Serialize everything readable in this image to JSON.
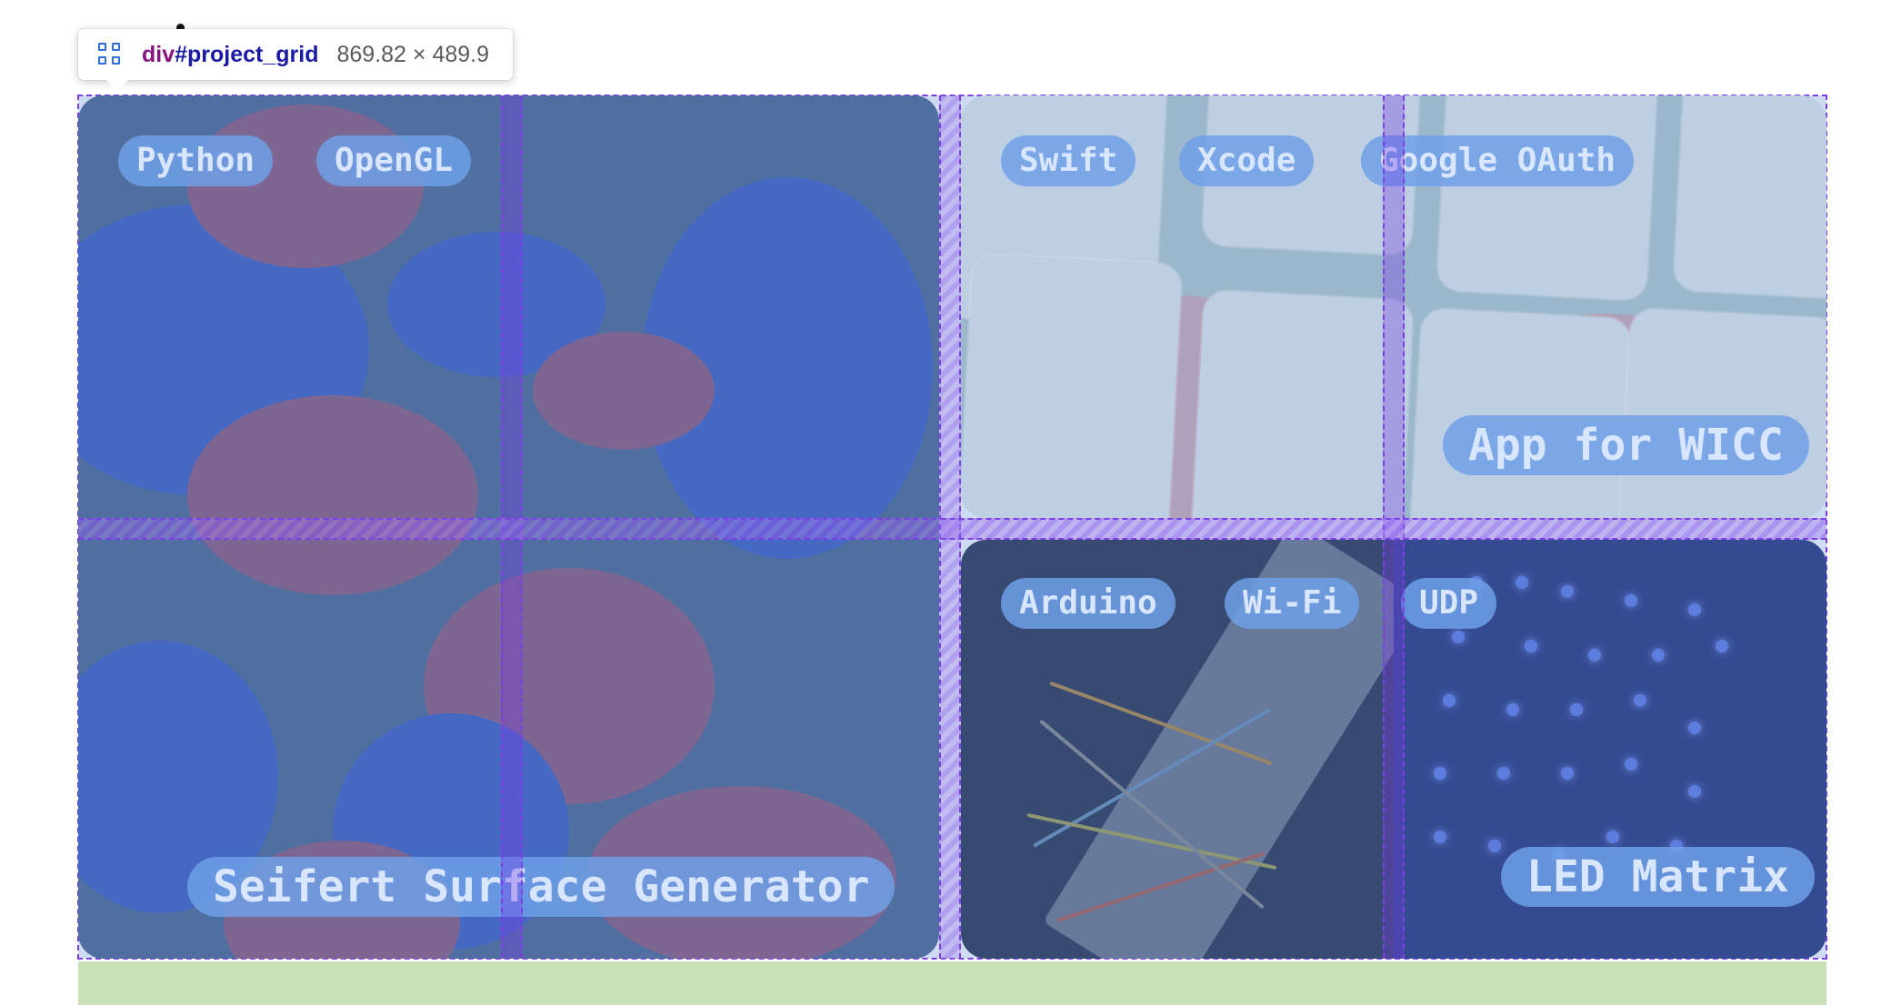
{
  "inspector": {
    "tag": "div",
    "id": "#project_grid",
    "dimensions": "869.82 × 489.9"
  },
  "projects": [
    {
      "title": "Seifert Surface Generator",
      "tags": [
        "Python",
        "OpenGL"
      ]
    },
    {
      "title": "App for WICC",
      "tags": [
        "Swift",
        "Xcode",
        "Google OAuth"
      ]
    },
    {
      "title": "LED Matrix",
      "tags": [
        "Arduino",
        "Wi-Fi",
        "UDP"
      ]
    }
  ],
  "colors": {
    "grid_overlay": "#a6bee9",
    "grid_line": "#7b3fe4",
    "pill": "#6ea0e8",
    "margin_highlight": "#c9dfb8"
  }
}
